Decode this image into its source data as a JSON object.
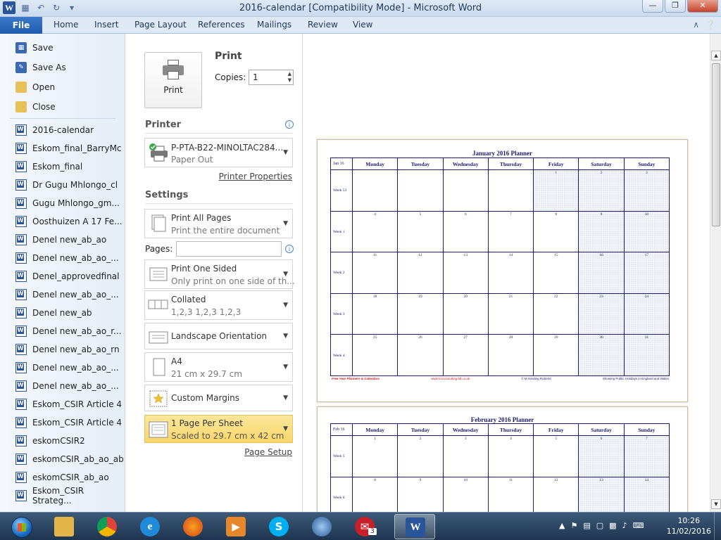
{
  "window": {
    "title": "2016-calendar [Compatibility Mode]  -  Microsoft Word",
    "app_icon": "W",
    "controls": [
      "minimize-icon",
      "restore-icon",
      "close-icon"
    ]
  },
  "ribbon": {
    "tabs": [
      "File",
      "Home",
      "Insert",
      "Page Layout",
      "References",
      "Mailings",
      "Review",
      "View"
    ]
  },
  "leftnav": {
    "commands": [
      "Save",
      "Save As",
      "Open",
      "Close"
    ],
    "recent": [
      "2016-calendar",
      "Eskom_final_BarryMc",
      "Eskom_final",
      "Dr Gugu Mhlongo_cl",
      "Gugu Mhlongo_gm...",
      "Oosthuizen A 17 Fe...",
      "Denel new_ab_ao",
      "Denel new_ab_ao_...",
      "Denel_approvedfinal",
      "Denel new_ab_ao_...",
      "Denel new_ab",
      "Denel new_ab_ao_r...",
      "Denel new_ab_ao_rn",
      "Denel new_ab_ao_...",
      "Denel new_ab_ao_...",
      "Eskom_CSIR Article 4",
      "Eskom_CSIR Article 4",
      "eskomCSIR2",
      "eskomCSIR_ab_ao_ab",
      "eskomCSIR_ab_ao",
      "Eskom_CSIR Strateg..."
    ]
  },
  "print": {
    "heading": "Print",
    "button": "Print",
    "copies_label": "Copies:",
    "copies_value": "1",
    "printer_heading": "Printer",
    "printer_name": "P-PTA-B22-MINOLTAC284...",
    "printer_status": "Paper Out",
    "printer_properties": "Printer Properties",
    "settings_heading": "Settings",
    "settings": [
      {
        "line1": "Print All Pages",
        "line2": "Print the entire document"
      },
      {
        "line1": "Print One Sided",
        "line2": "Only print on one side of th..."
      },
      {
        "line1": "Collated",
        "line2": "1,2,3    1,2,3    1,2,3"
      },
      {
        "line1": "Landscape Orientation",
        "line2": ""
      },
      {
        "line1": "A4",
        "line2": "21 cm x 29.7 cm"
      },
      {
        "line1": "Custom Margins",
        "line2": ""
      },
      {
        "line1": "1 Page Per Sheet",
        "line2": "Scaled to 29.7 cm x 42 cm"
      }
    ],
    "pages_label": "Pages:",
    "pages_value": "",
    "page_setup": "Page Setup"
  },
  "preview": {
    "pages": [
      {
        "title": "January 2016 Planner",
        "corner": "Jan 16",
        "days": [
          "Monday",
          "Tuesday",
          "Wednesday",
          "Thursday",
          "Friday",
          "Saturday",
          "Sunday"
        ],
        "weeks": [
          {
            "label": "Week 53",
            "dates": [
              "",
              "",
              "",
              "",
              "1",
              "2",
              "3"
            ]
          },
          {
            "label": "Week 1",
            "dates": [
              "4",
              "5",
              "6",
              "7",
              "8",
              "9",
              "10"
            ]
          },
          {
            "label": "Week 2",
            "dates": [
              "11",
              "12",
              "13",
              "14",
              "15",
              "16",
              "17"
            ]
          },
          {
            "label": "Week 3",
            "dates": [
              "18",
              "19",
              "20",
              "21",
              "22",
              "23",
              "24"
            ]
          },
          {
            "label": "Week 4",
            "dates": [
              "25",
              "26",
              "27",
              "28",
              "29",
              "30",
              "31"
            ]
          }
        ],
        "footer": [
          "Free Year Planners & Calendars",
          "www.tcsconsulting-ltd.co.uk",
          "© M Harding Roberts",
          "Showing Public Holidays in England and Wales"
        ]
      },
      {
        "title": "February 2016 Planner",
        "corner": "Feb 16",
        "days": [
          "Monday",
          "Tuesday",
          "Wednesday",
          "Thursday",
          "Friday",
          "Saturday",
          "Sunday"
        ],
        "weeks": [
          {
            "label": "Week 5",
            "dates": [
              "1",
              "2",
              "3",
              "4",
              "5",
              "6",
              "7"
            ]
          },
          {
            "label": "Week 6",
            "dates": [
              "8",
              "9",
              "10",
              "11",
              "12",
              "13",
              "14"
            ]
          }
        ]
      }
    ]
  },
  "taskbar": {
    "apps": [
      "file-explorer-icon",
      "chrome-icon",
      "internet-explorer-icon",
      "firefox-icon",
      "media-player-icon",
      "skype-icon",
      "network-icon",
      "mail-icon",
      "word-icon"
    ],
    "mail_badge": "3",
    "time": "10:26",
    "date": "11/02/2016"
  },
  "colors": {
    "accent": "#1c5bad",
    "selected_setting": "#f9d66a",
    "calendar_ink": "#1a1a6e",
    "footer_red": "#c02020"
  }
}
